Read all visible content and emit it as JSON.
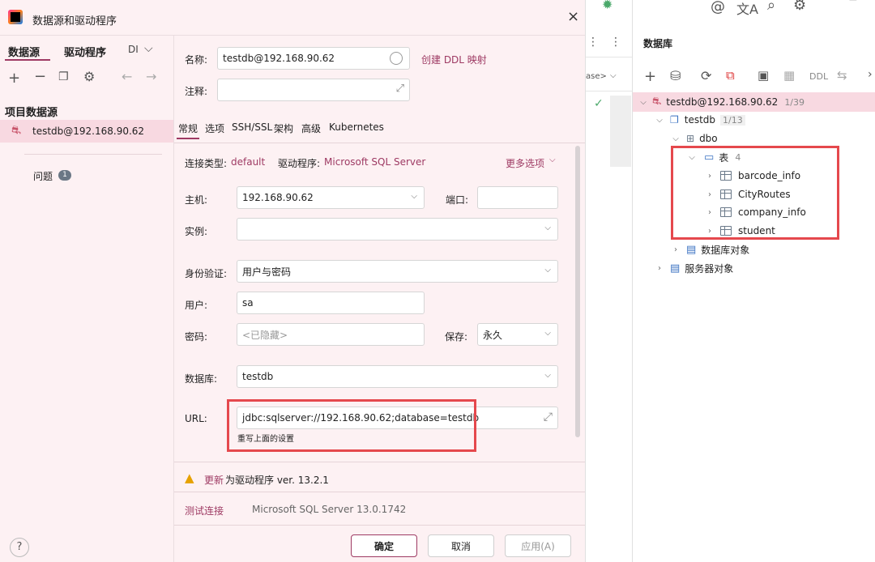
{
  "dialog": {
    "title": "数据源和驱动程序",
    "close": "×"
  },
  "left": {
    "tabs": [
      "数据源",
      "驱动程序",
      "DI"
    ],
    "section_title": "项目数据源",
    "selected_item": "testdb@192.168.90.62",
    "problems_label": "问题",
    "problems_count": "1"
  },
  "form": {
    "name_label": "名称:",
    "name_value": "testdb@192.168.90.62",
    "ddl_link": "创建 DDL 映射",
    "comment_label": "注释:",
    "tabs": [
      "常规",
      "选项",
      "SSH/SSL",
      "架构",
      "高级",
      "Kubernetes"
    ],
    "conn_type_label": "连接类型:",
    "conn_type_value": "default",
    "driver_label": "驱动程序:",
    "driver_value": "Microsoft SQL Server",
    "more_options": "更多选项",
    "host_label": "主机:",
    "host_value": "192.168.90.62",
    "port_label": "端口:",
    "instance_label": "实例:",
    "auth_label": "身份验证:",
    "auth_value": "用户与密码",
    "user_label": "用户:",
    "user_value": "sa",
    "password_label": "密码:",
    "password_placeholder": "<已隐藏>",
    "save_label": "保存:",
    "save_value": "永久",
    "database_label": "数据库:",
    "database_value": "testdb",
    "url_label": "URL:",
    "url_value": "jdbc:sqlserver://192.168.90.62;database=testdb",
    "url_hint": "重写上面的设置",
    "update_link": "更新",
    "update_text": "为驱动程序 ver. 13.2.1",
    "test_connection": "测试连接",
    "server_version": "Microsoft SQL Server 13.0.1742"
  },
  "buttons": {
    "ok": "确定",
    "cancel": "取消",
    "apply": "应用(A)",
    "help": "?"
  },
  "middle": {
    "dropdown_fragment": "ase>"
  },
  "right": {
    "title": "数据库",
    "ddl": "DDL",
    "root_label": "testdb@192.168.90.62",
    "root_count": "1/39",
    "db_label": "testdb",
    "db_count": "1/13",
    "schema_label": "dbo",
    "tables_label": "表",
    "tables_count": "4",
    "tables": [
      "barcode_info",
      "CityRoutes",
      "company_info",
      "student"
    ],
    "db_objects": "数据库对象",
    "server_objects": "服务器对象"
  },
  "colors": {
    "accent": "#9e3a63",
    "selected_bg": "#f8d9e1",
    "highlight_border": "#e5484d",
    "dialog_bg": "#fdf1f3"
  }
}
